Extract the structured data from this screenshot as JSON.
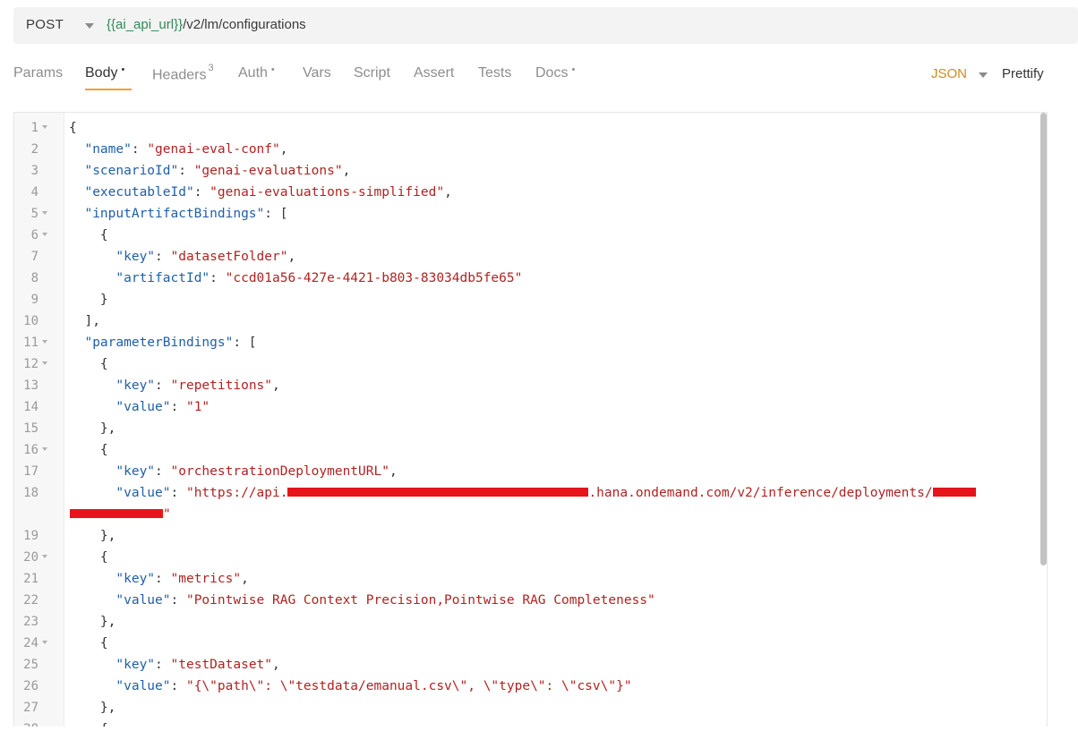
{
  "request": {
    "method": "POST",
    "url_var": "{{ai_api_url}}",
    "url_path": "/v2/lm/configurations"
  },
  "tabs": [
    {
      "label": "Params"
    },
    {
      "label": "Body",
      "dot": "•"
    },
    {
      "label": "Headers",
      "sup": "3"
    },
    {
      "label": "Auth",
      "dot": "•"
    },
    {
      "label": "Vars"
    },
    {
      "label": "Script"
    },
    {
      "label": "Assert"
    },
    {
      "label": "Tests"
    },
    {
      "label": "Docs",
      "dot": "•"
    }
  ],
  "body_mode": "JSON",
  "prettify_label": "Prettify",
  "colors": {
    "accent": "#f0a030",
    "json_key": "#1f5fa8",
    "json_string": "#b22222",
    "redaction": "#e8141b"
  },
  "editor": {
    "lines": [
      {
        "n": "1",
        "fold": true,
        "code": "{"
      },
      {
        "n": "2",
        "code": "  \"name\": \"genai-eval-conf\","
      },
      {
        "n": "3",
        "code": "  \"scenarioId\": \"genai-evaluations\","
      },
      {
        "n": "4",
        "code": "  \"executableId\": \"genai-evaluations-simplified\","
      },
      {
        "n": "5",
        "fold": true,
        "code": "  \"inputArtifactBindings\": ["
      },
      {
        "n": "6",
        "fold": true,
        "code": "    {"
      },
      {
        "n": "7",
        "code": "      \"key\": \"datasetFolder\","
      },
      {
        "n": "8",
        "code": "      \"artifactId\": \"ccd01a56-427e-4421-b803-83034db5fe65\""
      },
      {
        "n": "9",
        "code": "    }"
      },
      {
        "n": "10",
        "code": "  ],"
      },
      {
        "n": "11",
        "fold": true,
        "code": "  \"parameterBindings\": ["
      },
      {
        "n": "12",
        "fold": true,
        "code": "    {"
      },
      {
        "n": "13",
        "code": "      \"key\": \"repetitions\","
      },
      {
        "n": "14",
        "code": "      \"value\": \"1\""
      },
      {
        "n": "15",
        "code": "    },"
      },
      {
        "n": "16",
        "fold": true,
        "code": "    {"
      },
      {
        "n": "17",
        "code": "      \"key\": \"orchestrationDeploymentURL\","
      },
      {
        "n": "18",
        "code": "      \"value\": \"https://api.",
        "redacted": true,
        "code_after": ".hana.ondemand.com/v2/inference/deployments/"
      },
      {
        "n": "",
        "code": "\"",
        "wrap_redacted": true
      },
      {
        "n": "19",
        "code": "    },"
      },
      {
        "n": "20",
        "fold": true,
        "code": "    {"
      },
      {
        "n": "21",
        "code": "      \"key\": \"metrics\","
      },
      {
        "n": "22",
        "code": "      \"value\": \"Pointwise RAG Context Precision,Pointwise RAG Completeness\""
      },
      {
        "n": "23",
        "code": "    },"
      },
      {
        "n": "24",
        "fold": true,
        "code": "    {"
      },
      {
        "n": "25",
        "code": "      \"key\": \"testDataset\","
      },
      {
        "n": "26",
        "code": "      \"value\": \"{\\\"path\\\": \\\"testdata/emanual.csv\\\", \\\"type\\\": \\\"csv\\\"}\""
      },
      {
        "n": "27",
        "code": "    },"
      },
      {
        "n": "28",
        "code": "    {"
      }
    ]
  }
}
